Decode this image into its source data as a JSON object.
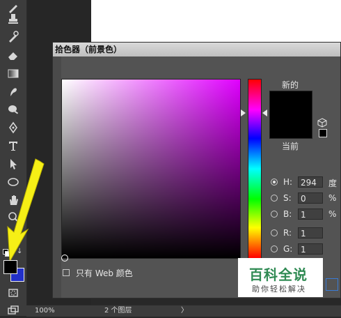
{
  "dialog": {
    "title": "拾色器（前景色）",
    "new_label": "新的",
    "current_label": "当前",
    "fields": [
      {
        "key": "H",
        "label": "H:",
        "value": "294",
        "unit": "度",
        "selected": true
      },
      {
        "key": "S",
        "label": "S:",
        "value": "0",
        "unit": "%",
        "selected": false
      },
      {
        "key": "B",
        "label": "B:",
        "value": "1",
        "unit": "%",
        "selected": false
      },
      {
        "key": "R",
        "label": "R:",
        "value": "1",
        "unit": "",
        "selected": false
      },
      {
        "key": "G",
        "label": "G:",
        "value": "1",
        "unit": "",
        "selected": false
      }
    ],
    "web_only_label": "只有 Web 颜色",
    "new_color": "#000000",
    "current_color": "#000000",
    "hue_color": "#e000ff"
  },
  "toolbar": {
    "tools": [
      "brush-icon",
      "stamp-icon",
      "history-brush-icon",
      "eraser-icon",
      "gradient-icon",
      "smudge-icon",
      "dodge-icon",
      "pen-icon",
      "type-icon",
      "path-select-icon",
      "ellipse-icon",
      "hand-icon",
      "zoom-icon",
      "more-icon"
    ],
    "foreground_color": "#000000",
    "background_color": "#2230c8"
  },
  "status": {
    "zoom": "100%",
    "layers": "2 个图层",
    "arrow": "〉"
  },
  "watermark": {
    "title": "百科全说",
    "subtitle": "助你轻松解决"
  }
}
